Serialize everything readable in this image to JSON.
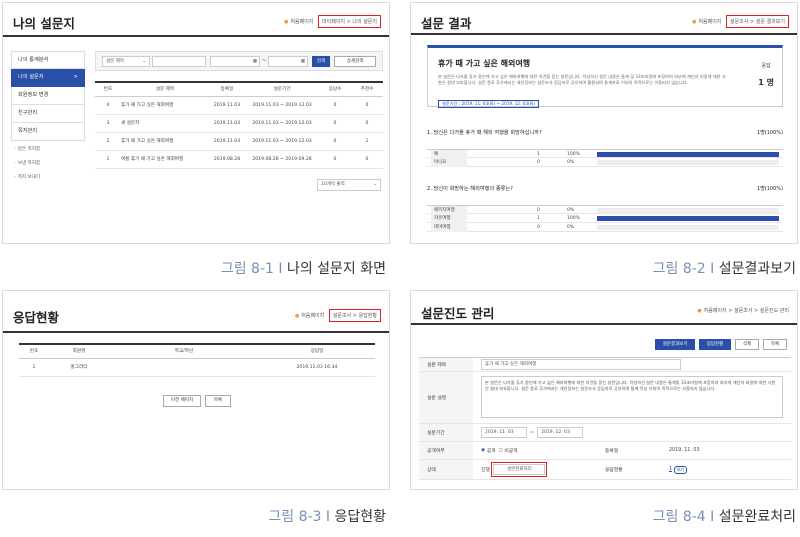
{
  "shot1": {
    "title": "나의 설문지",
    "breadcrumb": {
      "home": "처음페이지",
      "a": "마이페이지",
      "b": "나의 설문지"
    },
    "sidebar": [
      "나의 통계분석",
      "나의 설문지",
      "회원정보 변경",
      "친구관리",
      "쪽지관리"
    ],
    "sidebar_arrow": ">",
    "sidebar_sub": [
      "· 받은 쪽지함",
      "· 보낸 쪽지함",
      "· 쪽지 보내기"
    ],
    "search": {
      "select": "설문 제목",
      "date_sep": "~",
      "btn": "검색",
      "detail": "상세검색"
    },
    "table": {
      "headers": [
        "번호",
        "설문 제목",
        "등록일",
        "설문기간",
        "응답수",
        "추천수"
      ],
      "rows": [
        [
          "4",
          "휴가 때 가고 싶은 해외여행",
          "2019.11.03",
          "2019.11.03 ~ 2019.12.03",
          "0",
          "0"
        ],
        [
          "3",
          "새 설문지",
          "2019.11.03",
          "2019.11.03 ~ 2019.12.03",
          "0",
          "0"
        ],
        [
          "2",
          "휴가 때 가고 싶은 해외여행",
          "2019.11.03",
          "2019.11.03 ~ 2019.12.03",
          "0",
          "1"
        ],
        [
          "1",
          "여름 휴가 때 가고 싶은 해외여행",
          "2019.08.28",
          "2019.08.28 ~ 2019.09.28",
          "0",
          "0"
        ]
      ]
    },
    "pager": "10개씩 출력"
  },
  "shot2": {
    "title": "설문 결과",
    "breadcrumb": {
      "home": "처음페이지",
      "a": "설문조사",
      "b": "설문 결과보기"
    },
    "survey_title": "휴가 때 가고 싶은 해외여행",
    "desc": "본 설문은 다가올 휴가 중인에 가고 싶은 해외여행에 대한 의견을 묻는 설문입니다. 작성하신 설문 내용은 통계 및 33조비밀에 포함하여 외부에 개인의 비밀에 대한 사항은 절대 보호합니다. 설문 종료 후가에서는 개인정보는 설문조사 응답자로 공유하며 활용되며 통계자료 이외의 목적으로는 이용되지 않습니다.",
    "period": "설문기간 : 2019. 11. 03(화) ~ 2019. 12. 03(화)",
    "resp_label": "응답",
    "resp_count": "1 명",
    "q1": {
      "text": "1. 당신은 다가올 휴가 때 해외 여행을 희망하십니까?",
      "pct": "1명(100%)",
      "rows": [
        [
          "예",
          "1",
          "100%",
          1.0
        ],
        [
          "아니요",
          "0",
          "0%",
          0
        ]
      ]
    },
    "q2": {
      "text": "2. 당신이 희망하는 해외여행의 종류는?",
      "pct": "1명(100%)",
      "rows": [
        [
          "패키지여행",
          "0",
          "0%",
          0
        ],
        [
          "자유여행",
          "1",
          "100%",
          1.0
        ],
        [
          "테마여행",
          "0",
          "0%",
          0
        ]
      ]
    }
  },
  "shot3": {
    "title": "응답현황",
    "breadcrumb": {
      "home": "처음페이지",
      "a": "설문조사",
      "b": "응답현황"
    },
    "headers": [
      "번호",
      "회원명",
      "학교/학년",
      "응답일"
    ],
    "row": [
      "1",
      "홍그라더",
      "",
      "2019.11.03 16:34"
    ],
    "btn_prev": "이전 페이지",
    "btn_list": "목록"
  },
  "shot4": {
    "title": "설문진도 관리",
    "breadcrumb": {
      "home": "처음페이지",
      "a": "설문조사",
      "b": "설문진도 관리"
    },
    "buttons": [
      "설문결과보기",
      "응답현황",
      "삭제",
      "목록"
    ],
    "labels": {
      "title": "설문 제목",
      "desc": "설문 설명",
      "period": "설문기간",
      "open": "공개여부",
      "status": "상태",
      "reg": "등록일",
      "resp": "응답현황"
    },
    "values": {
      "title": "휴가 때 가고 싶은 해외여행",
      "desc": "본 설문은 다가올 휴가 중인에 가고 싶은 해외여행에 대한 의견을 묻는 설문입니다. 작성하신 설문 내용은 통계및 33조비밀에 포함하여 외부에 개인의 비밀에 대한 사항은 절대 보호합니다. 설문 종료 후가에서는 개인정보는 설문조사 응답자로 공유하며 통계 작성 이외의 목적으로는 사용되지 않습니다.",
      "d1": "2019. 11. 03",
      "d2": "2019. 12. 03",
      "sep": "~",
      "open_y": "공개",
      "open_n": "비공개",
      "status": "진행",
      "status_btn": "설문완료처리",
      "reg": "2019. 11. 03",
      "resp": "1",
      "resp_btn": "보기"
    }
  },
  "captions": [
    {
      "fig": "그림 8-1 I ",
      "text": "나의 설문지 화면"
    },
    {
      "fig": "그림 8-2 I ",
      "text": "설문결과보기"
    },
    {
      "fig": "그림 8-3 I ",
      "text": "응답현황"
    },
    {
      "fig": "그림 8-4 I ",
      "text": "설문완료처리"
    }
  ],
  "colors": {
    "accent": "#2a4fa8",
    "highlight": "#e02020",
    "home_icon": "#e7a23a"
  }
}
